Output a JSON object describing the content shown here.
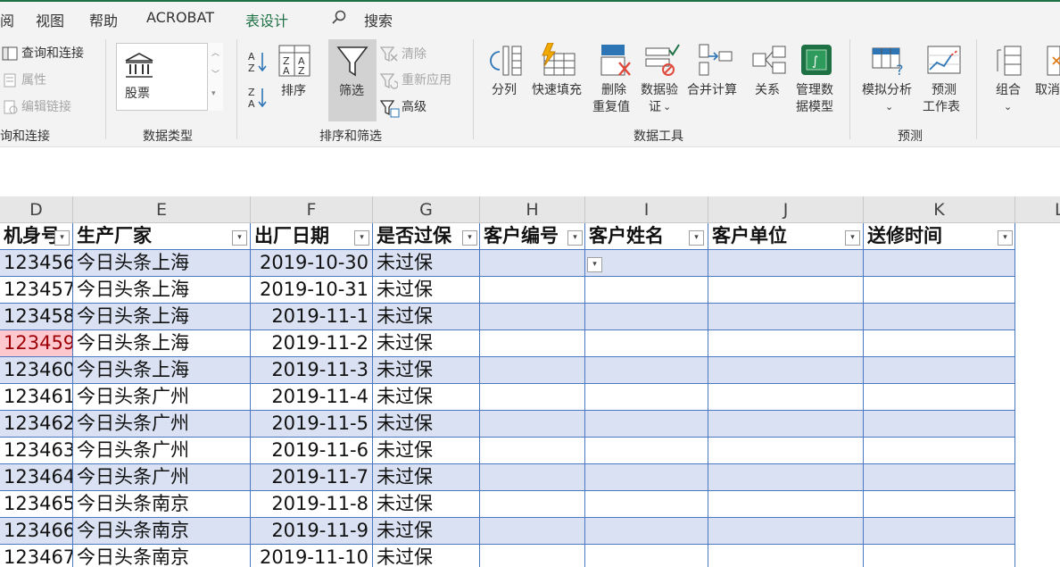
{
  "menu": {
    "items": [
      "阅",
      "视图",
      "帮助",
      "ACROBAT",
      "表设计"
    ],
    "search": "搜索"
  },
  "ribbon": {
    "query": {
      "items": [
        "查询和连接",
        "属性",
        "编辑链接"
      ],
      "label": "询和连接"
    },
    "datatype": {
      "value": "股票",
      "label": "数据类型"
    },
    "sort": {
      "sort": "排序",
      "filter": "筛选",
      "clear": "清除",
      "reapply": "重新应用",
      "advanced": "高级",
      "label": "排序和筛选"
    },
    "tools": {
      "split": "分列",
      "flash": "快速填充",
      "dedupe1": "删除",
      "dedupe2": "重复值",
      "validate1": "数据验",
      "validate2": "证",
      "consolidate": "合并计算",
      "relations": "关系",
      "model1": "管理数",
      "model2": "据模型",
      "label": "数据工具"
    },
    "forecast": {
      "whatif": "模拟分析",
      "sheet1": "预测",
      "sheet2": "工作表",
      "label": "预测"
    },
    "outline": {
      "group": "组合",
      "ungroup": "取消"
    }
  },
  "columns": [
    "D",
    "E",
    "F",
    "G",
    "H",
    "I",
    "J",
    "K",
    "L"
  ],
  "headers": [
    "机身号",
    "生产厂家",
    "出厂日期",
    "是否过保",
    "客户编号",
    "客户姓名",
    "客户单位",
    "送修时间"
  ],
  "rows": [
    [
      "123456",
      "今日头条上海",
      "2019-10-30",
      "未过保"
    ],
    [
      "123457",
      "今日头条上海",
      "2019-10-31",
      "未过保"
    ],
    [
      "123458",
      "今日头条上海",
      "2019-11-1",
      "未过保"
    ],
    [
      "123459",
      "今日头条上海",
      "2019-11-2",
      "未过保"
    ],
    [
      "123460",
      "今日头条上海",
      "2019-11-3",
      "未过保"
    ],
    [
      "123461",
      "今日头条广州",
      "2019-11-4",
      "未过保"
    ],
    [
      "123462",
      "今日头条广州",
      "2019-11-5",
      "未过保"
    ],
    [
      "123463",
      "今日头条广州",
      "2019-11-6",
      "未过保"
    ],
    [
      "123464",
      "今日头条广州",
      "2019-11-7",
      "未过保"
    ],
    [
      "123465",
      "今日头条南京",
      "2019-11-8",
      "未过保"
    ],
    [
      "123466",
      "今日头条南京",
      "2019-11-9",
      "未过保"
    ],
    [
      "123467",
      "今日头条南京",
      "2019-11-10",
      "未过保"
    ]
  ],
  "colors": {
    "accent": "#1e7145",
    "band": "#d9e1f2",
    "border": "#4a78c2",
    "highlight": "#ffc7ce"
  }
}
